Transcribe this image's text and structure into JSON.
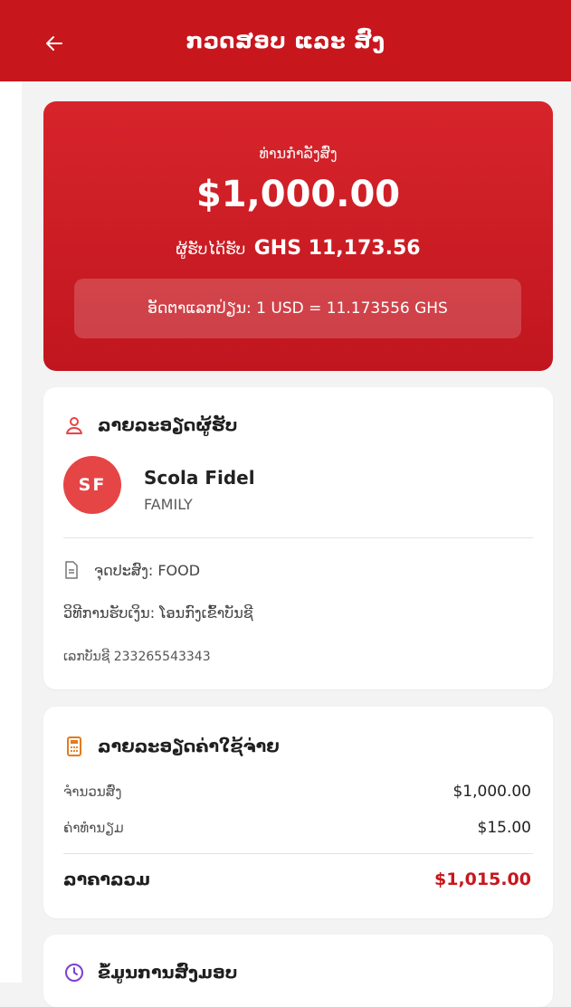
{
  "header": {
    "title": "ກວດສອບ ແລະ ສົ່ງ",
    "back_icon": "arrow-left-icon"
  },
  "summary": {
    "sending_label": "ທ່ານກໍາລັງສົ່ງ",
    "amount": "$1,000.00",
    "receive_label": "ຜູ້ຮັບໄດ້ຮັບ",
    "receive_amount": "GHS 11,173.56",
    "rate_text": "ອັດຕາແລກປ່ຽນ: 1 USD = 11.173556 GHS"
  },
  "recipient": {
    "section_title": "ລາຍລະອຽດຜູ້ຮັບ",
    "icon": "user-icon",
    "initials": "SF",
    "name": "Scola Fidel",
    "relationship": "FAMILY",
    "purpose": "ຈຸດປະສົງ: FOOD",
    "method": "ວິທີການຮັບເງິນ: ໂອນກົງເຂົ້າບັນຊີ",
    "account": "ເລກບັນຊີ 233265543343"
  },
  "costs": {
    "section_title": "ລາຍລະອຽດຄ່າໃຊ້ຈ່າຍ",
    "icon": "calculator-icon",
    "rows": [
      {
        "label": "ຈໍານວນສົ່ງ",
        "value": "$1,000.00"
      },
      {
        "label": "ຄ່າທໍານຽມ",
        "value": "$15.00"
      }
    ],
    "total_label": "ລາຄາລວມ",
    "total_value": "$1,015.00"
  },
  "delivery": {
    "section_title": "ຂໍ້ມູນການສົ່ງມອບ",
    "icon": "clock-icon"
  },
  "colors": {
    "brand_red": "#c8161d",
    "accent_red": "#e64545",
    "background": "#f3f3f3"
  }
}
